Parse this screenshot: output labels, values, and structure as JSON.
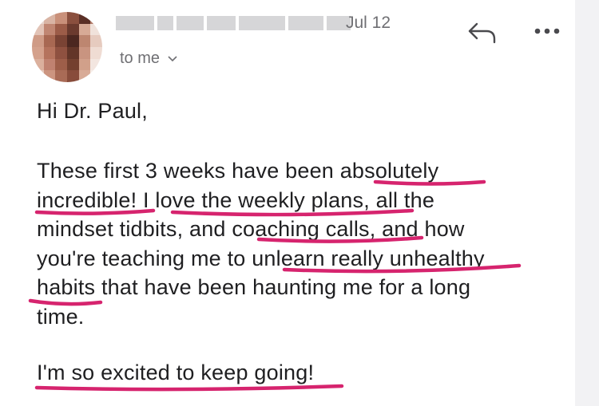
{
  "header": {
    "date": "Jul 12",
    "recipient_label": "to me",
    "recipient_chevron": "chevron-down-icon",
    "reply_icon": "reply-icon",
    "more_icon": "more-horizontal-icon"
  },
  "message": {
    "greeting": "Hi Dr. Paul,",
    "lines": [
      "These first 3 weeks have been absolutely",
      "incredible! I love the weekly plans, all the",
      "mindset tidbits, and coaching calls, and how",
      "you're teaching me to unlearn really unhealthy",
      "habits that have been haunting me for a long",
      "time."
    ],
    "closing": "I'm so excited to keep going!"
  },
  "colors": {
    "underline": "#d6246e",
    "meta_text": "#6f6f73",
    "body_text": "#1f1f21"
  }
}
